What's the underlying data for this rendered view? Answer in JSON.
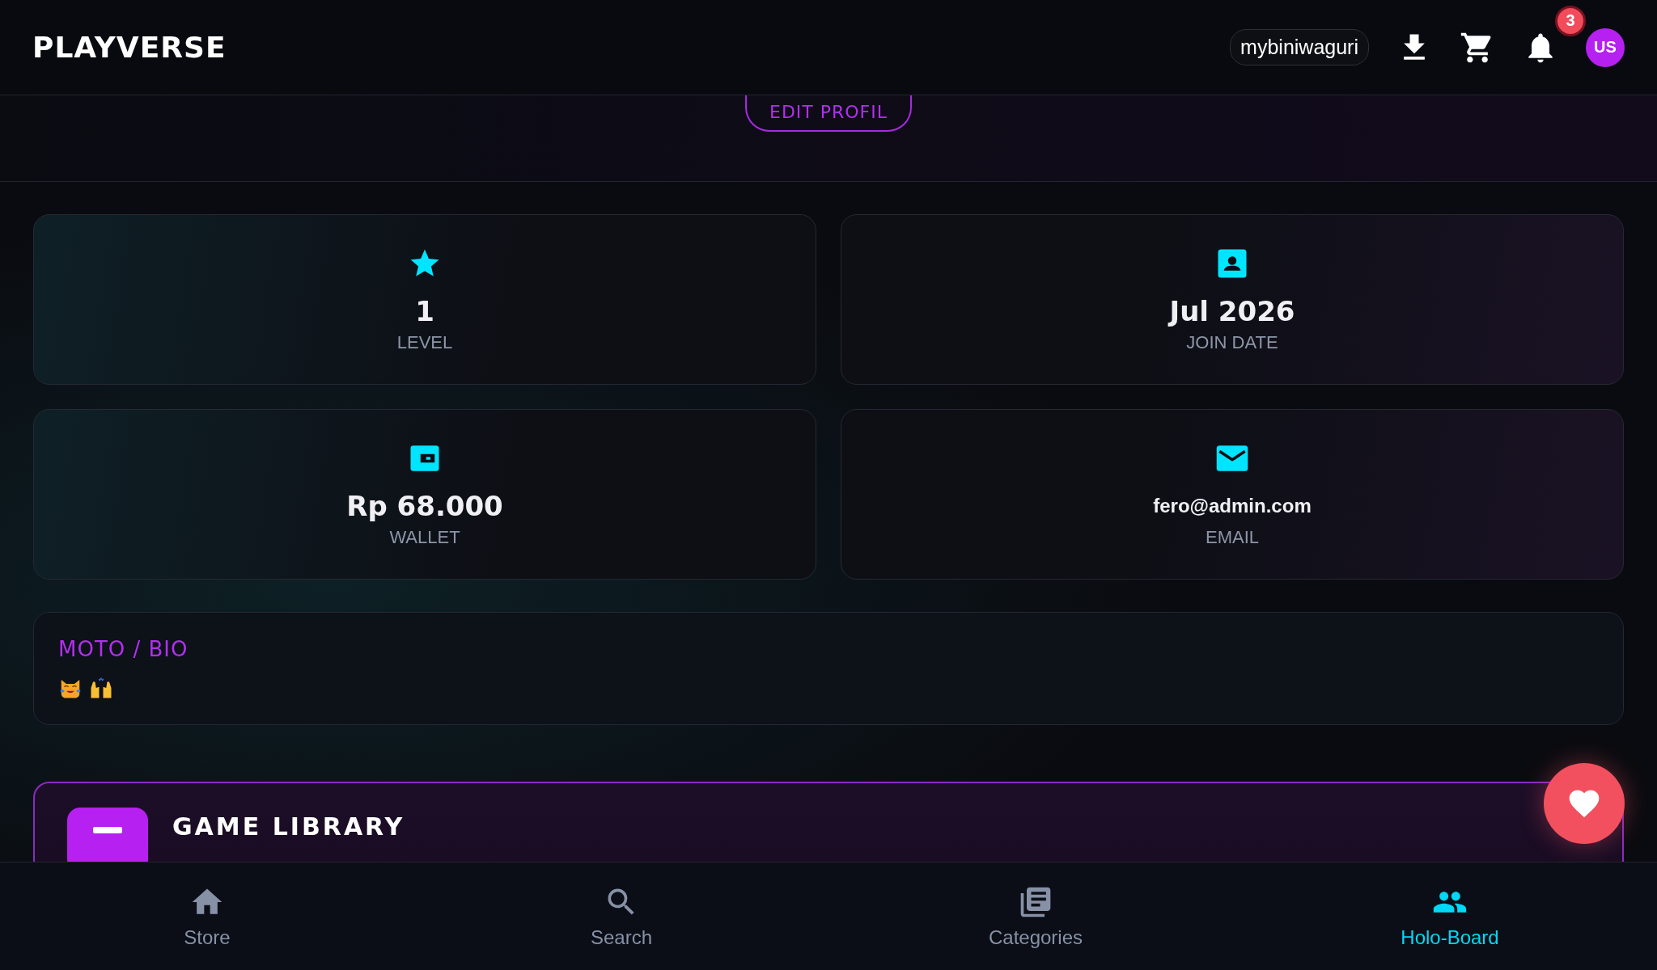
{
  "header": {
    "logo": "PLAYVERSE",
    "username": "mybiniwaguri",
    "notification_count": "3",
    "avatar": "US"
  },
  "profile": {
    "edit_button": "EDIT PROFIL"
  },
  "stats": [
    {
      "kind": "star",
      "value": "1",
      "label": "LEVEL"
    },
    {
      "kind": "calendar",
      "value": "Jul 2026",
      "label": "JOIN DATE"
    },
    {
      "kind": "wallet",
      "value": "Rp 68.000",
      "label": "WALLET"
    },
    {
      "kind": "mail",
      "value": "fero@admin.com",
      "label": "EMAIL"
    }
  ],
  "bio": {
    "title": "MOTO / BIO"
  },
  "game_library": {
    "title": "GAME LIBRARY"
  },
  "bottom_nav": [
    {
      "kind": "home",
      "label": "Store",
      "selected": false
    },
    {
      "kind": "search",
      "label": "Search",
      "selected": false
    },
    {
      "kind": "book",
      "label": "Categories",
      "selected": false
    },
    {
      "kind": "people",
      "label": "Holo-Board",
      "selected": true
    }
  ]
}
